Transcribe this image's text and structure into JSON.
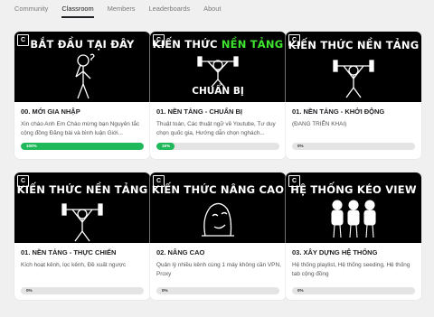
{
  "nav": {
    "tabs": [
      {
        "label": "Community",
        "active": false
      },
      {
        "label": "Classroom",
        "active": true
      },
      {
        "label": "Members",
        "active": false
      },
      {
        "label": "Leaderboards",
        "active": false
      },
      {
        "label": "About",
        "active": false
      }
    ]
  },
  "colors": {
    "accent_green": "#1fb85a",
    "highlight_green": "#3fe52f",
    "thumb_bg": "#000000"
  },
  "courses": [
    {
      "thumb_title": "BẮT ĐẦU TẠI ĐÂY",
      "thumb_icon": "stick-figure-thinking",
      "title": "00. MỚI GIA NHẬP",
      "description": "Xin chào Anh Em Chào mừng bạn Nguyên tắc cộng đồng Đăng bài và bình luận Giới...",
      "progress": 100,
      "progress_label": "100%"
    },
    {
      "thumb_title_a": "KIẾN THỨC ",
      "thumb_title_hl": "NỀN TẢNG",
      "thumb_sub": "CHUẨN BỊ",
      "thumb_icon": "stick-figure-lifting",
      "title": "01. NỀN TẢNG - CHUẨN BỊ",
      "description": "Thuật toán, Các thuật ngữ về Youtube, Tư duy chọn quốc gia, Hướng dẫn chọn nghách...",
      "progress": 15,
      "progress_label": "15%"
    },
    {
      "thumb_title": "KIẾN THỨC NỀN TẢNG",
      "thumb_icon": "stick-figure-lifting",
      "title": "01. NỀN TẢNG - KHỞI ĐỘNG",
      "description": "(ĐANG TRIỂN KHAI)",
      "progress": 0,
      "progress_label": "0%"
    },
    {
      "thumb_title": "KIẾN THỨC NỀN TẢNG",
      "thumb_icon": "stick-figure-lifting",
      "title": "01. NỀN TẢNG - THỰC CHIẾN",
      "description": "Kích hoạt kênh, lọc kênh, Đề xuất ngược",
      "progress": 0,
      "progress_label": "0%"
    },
    {
      "thumb_title": "KIẾN THỨC NÂNG CAO",
      "thumb_icon": "meme-face",
      "title": "02. NÂNG CAO",
      "description": "Quản lý nhiều kênh cùng 1 máy không cần VPN, Proxy",
      "progress": 0,
      "progress_label": "0%"
    },
    {
      "thumb_title": "HỆ THỐNG KÉO VIEW",
      "thumb_icon": "three-figures",
      "title": "03. XÂY DỰNG HỆ THỐNG",
      "description": "Hệ thống playlist, Hệ thống seeding, Hệ thống tab cộng đồng",
      "progress": 0,
      "progress_label": "0%"
    }
  ]
}
